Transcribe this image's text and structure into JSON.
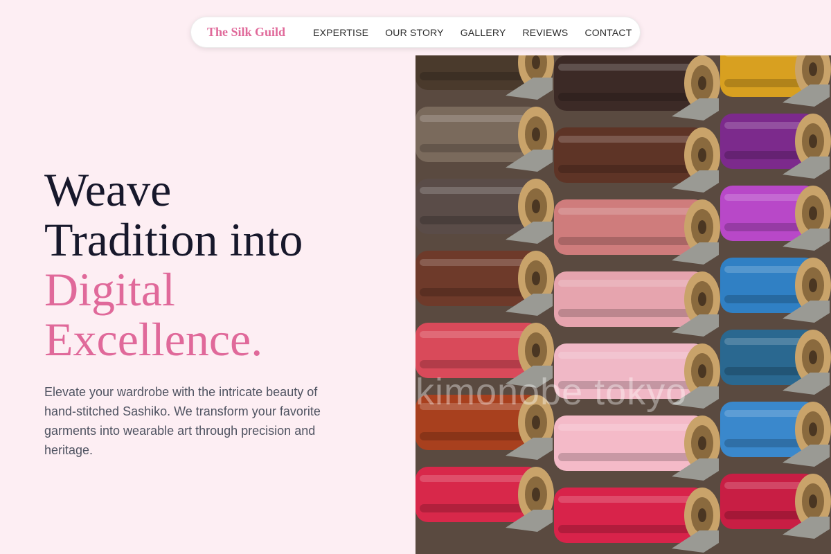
{
  "nav": {
    "brand": "The Silk Guild",
    "links": [
      "EXPERTISE",
      "OUR STORY",
      "GALLERY",
      "REVIEWS",
      "CONTACT"
    ]
  },
  "hero": {
    "headline_line1": "Weave",
    "headline_line2": "Tradition into",
    "headline_accent1": "Digital",
    "headline_accent2": "Excellence.",
    "description": "Elevate your wardrobe with the intricate beauty of hand-stitched Sashiko. We transform your favorite garments into wearable art through precision and heritage.",
    "image_watermark": "kimonobe    tokyo"
  },
  "colors": {
    "background": "#fdeef3",
    "accent": "#e0699a",
    "heading": "#17182b",
    "body_text": "#4f5361"
  },
  "image": {
    "subject": "rows of thread spools",
    "columns": [
      [
        "#4a3a2c",
        "#7a6a5c",
        "#5a4c48",
        "#6e3a2a",
        "#d94a5a",
        "#a8401e",
        "#d8284a"
      ],
      [
        "#3c2a26",
        "#5e3426",
        "#cf7c7c",
        "#e6a4ae",
        "#f0b8c6",
        "#f4bac8",
        "#d8234a"
      ],
      [
        "#d8a020",
        "#7c2a8c",
        "#b848c8",
        "#3080c4",
        "#2a6890",
        "#3a88cc",
        "#c81e44"
      ]
    ]
  }
}
